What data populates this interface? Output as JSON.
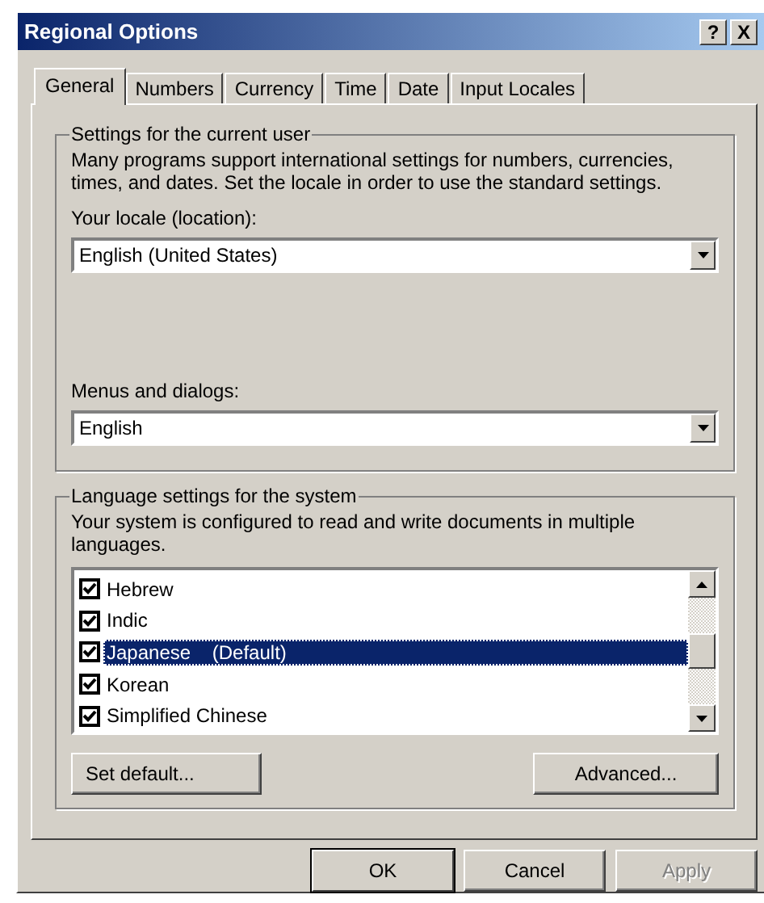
{
  "window": {
    "title": "Regional Options",
    "help_button": "?",
    "close_button": "X"
  },
  "tabs": [
    {
      "label": "General",
      "selected": true
    },
    {
      "label": "Numbers",
      "selected": false
    },
    {
      "label": "Currency",
      "selected": false
    },
    {
      "label": "Time",
      "selected": false
    },
    {
      "label": "Date",
      "selected": false
    },
    {
      "label": "Input Locales",
      "selected": false
    }
  ],
  "user_settings": {
    "title": "Settings for the current user",
    "description": "Many programs support international settings for numbers, currencies, times, and dates. Set the locale in order to use the standard settings.",
    "locale": {
      "label": "Your locale (location):",
      "value": "English (United States)"
    },
    "menus": {
      "label": "Menus and dialogs:",
      "value": "English"
    }
  },
  "system_settings": {
    "title": "Language settings for the system",
    "description": "Your system is configured to read and write documents in multiple languages.",
    "languages": [
      {
        "label": "Hebrew",
        "checked": true,
        "selected": false
      },
      {
        "label": "Indic",
        "checked": true,
        "selected": false
      },
      {
        "label": "Japanese    (Default)",
        "checked": true,
        "selected": true
      },
      {
        "label": "Korean",
        "checked": true,
        "selected": false
      },
      {
        "label": "Simplified Chinese",
        "checked": true,
        "selected": false
      }
    ],
    "set_default_button": {
      "label": "Set default..."
    },
    "advanced_button": {
      "label": "Advanced..."
    }
  },
  "buttons": [
    {
      "label": "OK",
      "default": true,
      "disabled": false
    },
    {
      "label": "Cancel",
      "default": false,
      "disabled": false
    },
    {
      "label": "Apply",
      "default": false,
      "disabled": true
    }
  ]
}
